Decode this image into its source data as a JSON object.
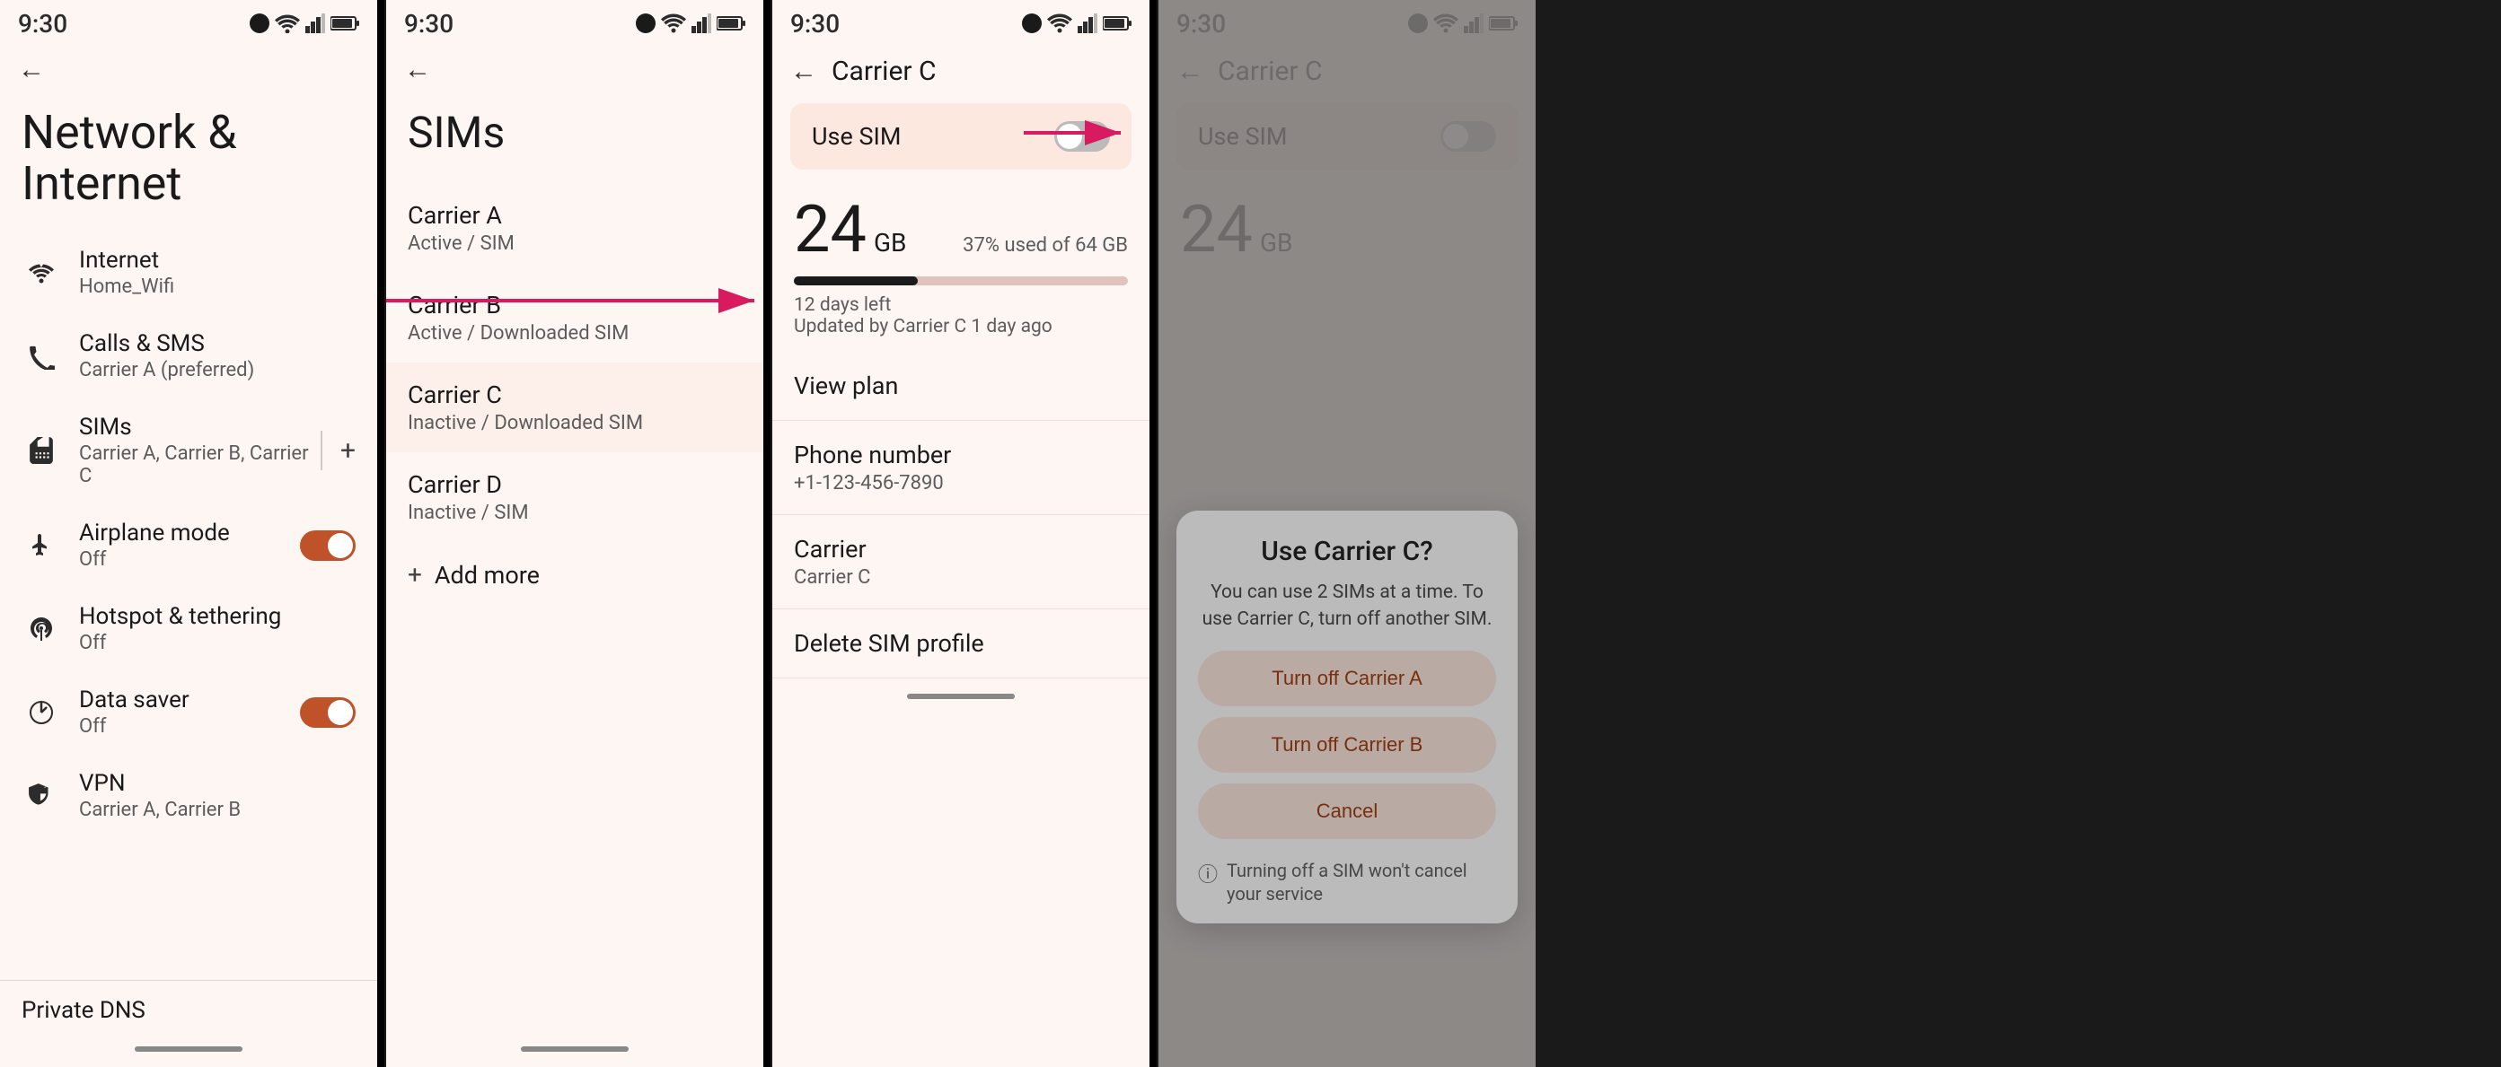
{
  "screens": {
    "screen1": {
      "status_time": "9:30",
      "title": "Network & Internet",
      "items": [
        {
          "id": "internet",
          "title": "Internet",
          "subtitle": "Home_Wifi",
          "icon": "wifi"
        },
        {
          "id": "calls-sms",
          "title": "Calls & SMS",
          "subtitle": "Carrier A (preferred)",
          "icon": "phone"
        },
        {
          "id": "sims",
          "title": "SIMs",
          "subtitle": "Carrier A, Carrier B, Carrier C",
          "icon": "sim",
          "has_add": true
        },
        {
          "id": "airplane-mode",
          "title": "Airplane mode",
          "subtitle": "Off",
          "icon": "airplane",
          "toggle": true,
          "toggle_on": true
        },
        {
          "id": "hotspot",
          "title": "Hotspot & tethering",
          "subtitle": "Off",
          "icon": "hotspot"
        },
        {
          "id": "data-saver",
          "title": "Data saver",
          "subtitle": "Off",
          "icon": "data-saver",
          "toggle": true,
          "toggle_on": true
        },
        {
          "id": "vpn",
          "title": "VPN",
          "subtitle": "Carrier A, Carrier B",
          "icon": "vpn"
        }
      ],
      "private_dns_label": "Private DNS"
    },
    "screen2": {
      "status_time": "9:30",
      "title": "SIMs",
      "carriers": [
        {
          "id": "carrier-a",
          "name": "Carrier A",
          "status": "Active / SIM"
        },
        {
          "id": "carrier-b",
          "name": "Carrier B",
          "status": "Active / Downloaded SIM"
        },
        {
          "id": "carrier-c",
          "name": "Carrier C",
          "status": "Inactive / Downloaded SIM"
        },
        {
          "id": "carrier-d",
          "name": "Carrier D",
          "status": "Inactive / SIM"
        }
      ],
      "add_more_label": "Add more"
    },
    "screen3": {
      "status_time": "9:30",
      "page_title": "Carrier C",
      "use_sim_label": "Use SIM",
      "data_amount": "24",
      "data_unit": "GB",
      "data_percent": "37% used of 64 GB",
      "days_left": "12 days left",
      "updated": "Updated by Carrier C 1 day ago",
      "progress_fill_pct": 37,
      "view_plan": "View plan",
      "phone_number_label": "Phone number",
      "phone_number": "+1-123-456-7890",
      "carrier_label": "Carrier",
      "carrier_value": "Carrier C",
      "delete_sim_label": "Delete SIM profile"
    },
    "screen4": {
      "status_time": "9:30",
      "page_title": "Carrier C",
      "use_sim_label": "Use SIM",
      "data_amount": "24",
      "dialog": {
        "title": "Use Carrier C?",
        "description": "You can use 2 SIMs at a time. To use Carrier C, turn off another SIM.",
        "btn1": "Turn off Carrier A",
        "btn2": "Turn off Carrier B",
        "btn_cancel": "Cancel",
        "note": "Turning off a SIM won't cancel your service"
      }
    }
  },
  "colors": {
    "accent": "#c0522a",
    "bg": "#fdf6f3",
    "toggle_on": "#c0522a",
    "toggle_off": "#9e9e9e",
    "pink_bg": "#fde8df",
    "progress_fill": "#1a1a1a",
    "progress_bg": "#e0c4bb"
  }
}
